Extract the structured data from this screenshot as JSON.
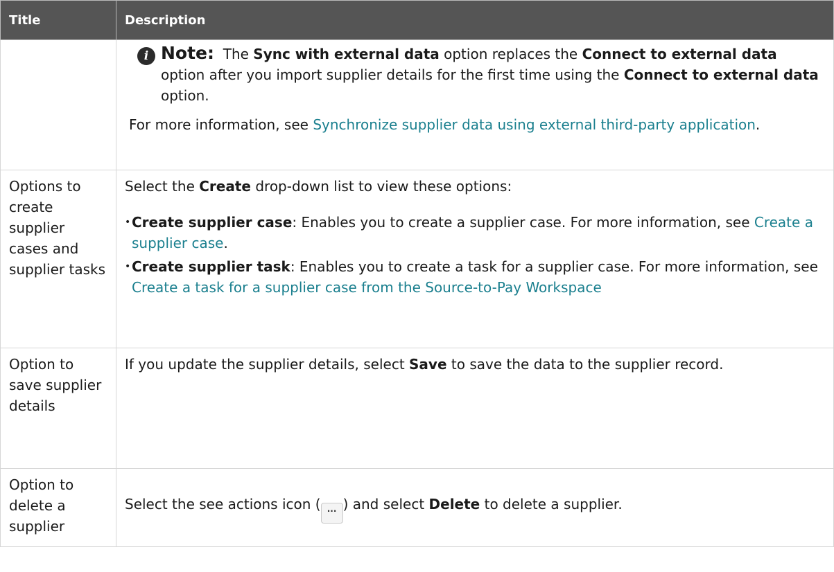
{
  "table": {
    "headers": {
      "title": "Title",
      "description": "Description"
    },
    "note": {
      "label": "Note:",
      "t1": "The",
      "b1": "Sync with external data",
      "t2": "option replaces the",
      "b2": "Connect to external data",
      "t3": "option after you import supplier details for the first time using the",
      "b3": "Connect to external data",
      "t4": "option."
    },
    "more_info": {
      "text": "For more information, see",
      "link": "Synchronize supplier data using external third-party application",
      "end": "."
    },
    "row_create": {
      "title": "Options to create supplier cases and supplier tasks",
      "intro_t1": "Select the",
      "intro_b": "Create",
      "intro_t2": "drop-down list to view these options:",
      "items": [
        {
          "label": "Create supplier case",
          "text": ": Enables you to create a supplier case. For more information, see",
          "link": "Create a supplier case",
          "end": "."
        },
        {
          "label": "Create supplier task",
          "text": ": Enables you to create a task for a supplier case. For more information, see",
          "link": "Create a task for a supplier case from the Source-to-Pay Workspace",
          "end": ""
        }
      ]
    },
    "row_save": {
      "title": "Option to save supplier details",
      "t1": "If you update the supplier details, select",
      "b": "Save",
      "t2": "to save the data to the supplier record."
    },
    "row_delete": {
      "title": "Option to delete a supplier",
      "t1": "Select the see actions icon (",
      "icon": "more-actions-icon",
      "icon_glyph": "...",
      "t2": ") and select",
      "b": "Delete",
      "t3": "to delete a supplier."
    }
  }
}
